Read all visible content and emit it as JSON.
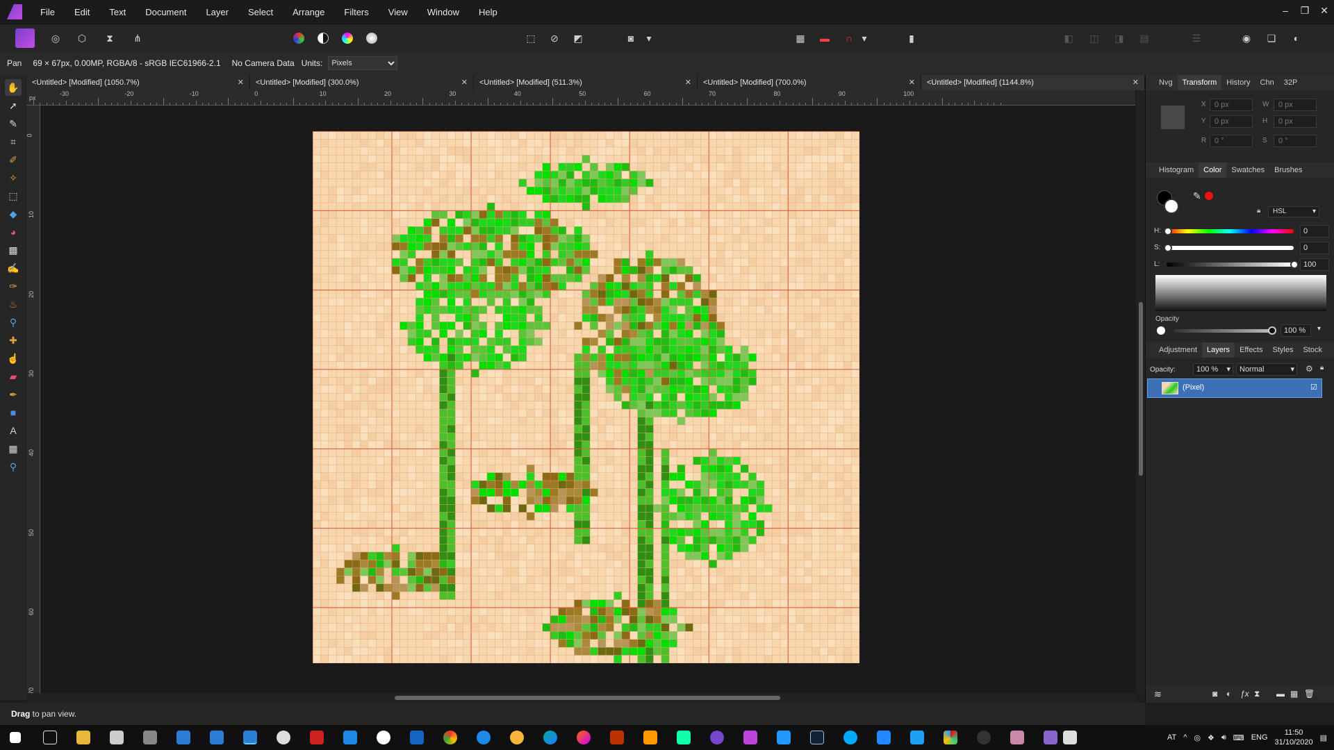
{
  "menu": [
    "File",
    "Edit",
    "Text",
    "Document",
    "Layer",
    "Select",
    "Arrange",
    "Filters",
    "View",
    "Window",
    "Help"
  ],
  "context": {
    "tool": "Pan",
    "doc_info": "69 × 67px, 0.00MP, RGBA/8 - sRGB IEC61966-2.1",
    "camera": "No Camera Data",
    "units_label": "Units:",
    "units_value": "Pixels"
  },
  "tabs": [
    {
      "label": "<Untitled> [Modified] (1050.7%)"
    },
    {
      "label": "<Untitled> [Modified] (300.0%)"
    },
    {
      "label": "<Untitled> [Modified] (511.3%)"
    },
    {
      "label": "<Untitled> [Modified] (700.0%)"
    },
    {
      "label": "<Untitled> [Modified] (1144.8%)"
    }
  ],
  "ruler_unit": "px",
  "ruler_top_labels": [
    "-30",
    "-20",
    "-10",
    "0",
    "10",
    "20",
    "30",
    "40",
    "50",
    "60",
    "70",
    "80",
    "90",
    "100"
  ],
  "ruler_left_labels": [
    "0",
    "10",
    "20",
    "30",
    "40",
    "50",
    "60",
    "70"
  ],
  "status": {
    "bold": "Drag",
    "text": " to pan view."
  },
  "panel_top": {
    "tabs": [
      "Nvg",
      "Transform",
      "History",
      "Chn",
      "32P"
    ],
    "active": "Transform",
    "fields": {
      "x": "0 px",
      "y": "0 px",
      "w": "0 px",
      "h": "0 px",
      "r": "0 °",
      "s": "0 °"
    }
  },
  "panel_color": {
    "tabs": [
      "Histogram",
      "Color",
      "Swatches",
      "Brushes"
    ],
    "active": "Color",
    "mode": "HSL",
    "h_label": "H:",
    "h_value": "0",
    "s_label": "S:",
    "s_value": "0",
    "l_label": "L:",
    "l_value": "100",
    "opacity_label": "Opacity",
    "opacity_value": "100 %"
  },
  "panel_layers": {
    "tabs": [
      "Adjustment",
      "Layers",
      "Effects",
      "Styles",
      "Stock"
    ],
    "active": "Layers",
    "opacity_label": "Opacity:",
    "opacity_value": "100 %",
    "blend": "Normal",
    "layer_name": "(Pixel)"
  },
  "tray": {
    "lang_short": "AT",
    "lang": "ENG",
    "time": "11:50",
    "date": "31/10/2020"
  },
  "colors": {
    "accent": "#3b6fb6",
    "canvas_bg": "#f7d7ae",
    "grid": "#e5a67a",
    "grid_major": "#dd6040"
  },
  "image": {
    "width": 69,
    "height": 67
  }
}
